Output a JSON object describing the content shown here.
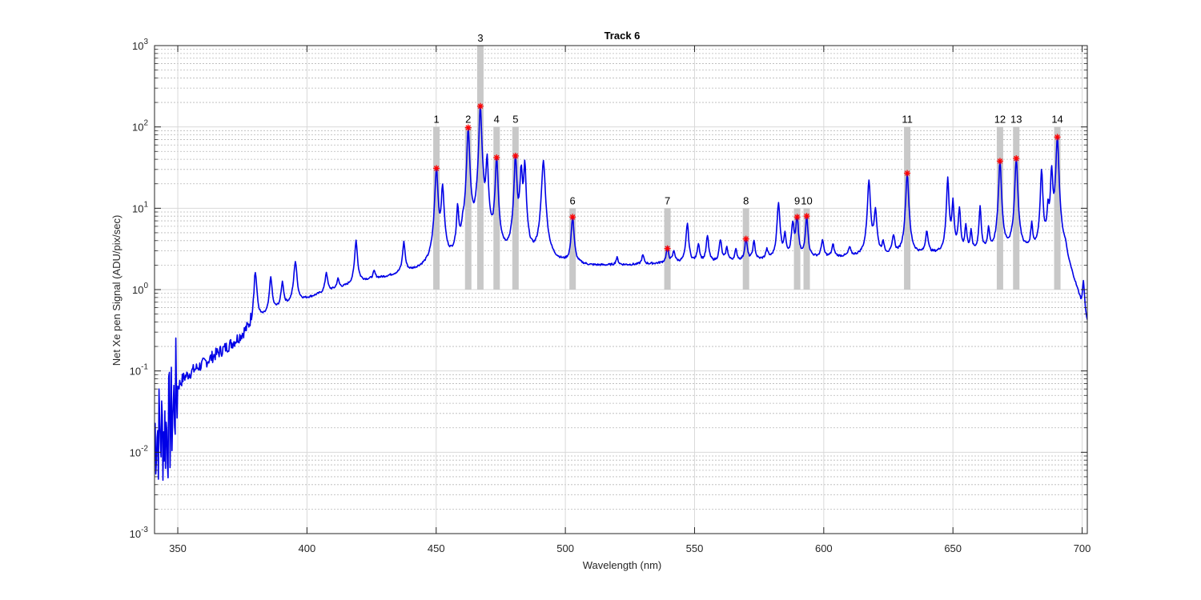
{
  "chart_data": {
    "type": "line",
    "title": "Track 6",
    "xlabel": "Wavelength (nm)",
    "ylabel": "Net Xe pen Signal (ADU/pix/sec)",
    "xlim": [
      341,
      702
    ],
    "ylim": [
      0.001,
      1000
    ],
    "yscale": "log",
    "grid": true,
    "x_ticks": [
      "350",
      "400",
      "450",
      "500",
      "550",
      "600",
      "650",
      "700"
    ],
    "y_ticks": [
      {
        "base": "10",
        "exp": "-3"
      },
      {
        "base": "10",
        "exp": "-2"
      },
      {
        "base": "10",
        "exp": "-1"
      },
      {
        "base": "10",
        "exp": "0"
      },
      {
        "base": "10",
        "exp": "1"
      },
      {
        "base": "10",
        "exp": "2"
      },
      {
        "base": "10",
        "exp": "3"
      }
    ],
    "line_color": "#0000e6",
    "band_color": "#c8c8c8",
    "marker_color": "#ff0000",
    "peaks": [
      {
        "label": "1",
        "x": 450.1,
        "y": 31,
        "band_top": 100
      },
      {
        "label": "2",
        "x": 462.4,
        "y": 98,
        "band_top": 100
      },
      {
        "label": "3",
        "x": 467.1,
        "y": 180,
        "band_top": 1000
      },
      {
        "label": "4",
        "x": 473.4,
        "y": 42,
        "band_top": 100
      },
      {
        "label": "5",
        "x": 480.7,
        "y": 44,
        "band_top": 100
      },
      {
        "label": "6",
        "x": 502.8,
        "y": 7.8,
        "band_top": 10
      },
      {
        "label": "7",
        "x": 539.5,
        "y": 3.2,
        "band_top": 10
      },
      {
        "label": "8",
        "x": 569.9,
        "y": 4.2,
        "band_top": 10
      },
      {
        "label": "9",
        "x": 589.7,
        "y": 7.8,
        "band_top": 10
      },
      {
        "label": "10",
        "x": 593.4,
        "y": 8.0,
        "band_top": 10
      },
      {
        "label": "11",
        "x": 632.3,
        "y": 27,
        "band_top": 100
      },
      {
        "label": "12",
        "x": 668.2,
        "y": 38,
        "band_top": 100
      },
      {
        "label": "13",
        "x": 674.5,
        "y": 41,
        "band_top": 100
      },
      {
        "label": "14",
        "x": 690.4,
        "y": 75,
        "band_top": 100
      }
    ],
    "series": [
      {
        "baseline": [
          [
            341,
            0.01
          ],
          [
            344,
            0.008
          ],
          [
            347,
            0.012
          ],
          [
            349.5,
            0.05
          ],
          [
            352,
            0.07
          ],
          [
            356,
            0.09
          ],
          [
            360,
            0.11
          ],
          [
            364,
            0.14
          ],
          [
            368,
            0.17
          ],
          [
            372,
            0.21
          ],
          [
            376,
            0.27
          ],
          [
            379,
            0.3
          ],
          [
            382,
            0.4
          ],
          [
            386,
            0.5
          ],
          [
            390,
            0.58
          ],
          [
            395,
            0.65
          ],
          [
            400,
            0.75
          ],
          [
            405,
            0.85
          ],
          [
            410,
            0.95
          ],
          [
            415,
            1.05
          ],
          [
            420,
            1.2
          ],
          [
            425,
            1.28
          ],
          [
            430,
            1.35
          ],
          [
            435,
            1.45
          ],
          [
            440,
            1.55
          ],
          [
            445,
            1.65
          ],
          [
            450,
            1.75
          ],
          [
            455,
            1.8
          ],
          [
            460,
            1.9
          ],
          [
            470,
            2.0
          ],
          [
            480,
            2.0
          ],
          [
            490,
            2.0
          ],
          [
            500,
            2.0
          ],
          [
            510,
            1.9
          ],
          [
            520,
            1.95
          ],
          [
            530,
            2.0
          ],
          [
            540,
            2.1
          ],
          [
            550,
            2.1
          ],
          [
            560,
            2.15
          ],
          [
            570,
            2.2
          ],
          [
            580,
            2.3
          ],
          [
            590,
            2.4
          ],
          [
            600,
            2.45
          ],
          [
            610,
            2.5
          ],
          [
            620,
            2.5
          ],
          [
            630,
            2.55
          ],
          [
            640,
            2.65
          ],
          [
            650,
            2.7
          ],
          [
            660,
            2.75
          ],
          [
            670,
            2.8
          ],
          [
            680,
            2.8
          ],
          [
            686,
            2.6
          ],
          [
            690,
            2.4
          ],
          [
            693,
            2.0
          ],
          [
            695,
            1.4
          ],
          [
            697,
            0.9
          ],
          [
            699,
            0.55
          ],
          [
            700,
            0.35
          ],
          [
            701,
            0.3
          ],
          [
            702,
            0.2
          ]
        ],
        "lines": [
          [
            380,
            1.6,
            0.6
          ],
          [
            386,
            1.4,
            0.5
          ],
          [
            390.5,
            1.2,
            0.5
          ],
          [
            395.5,
            2.2,
            0.6
          ],
          [
            407.5,
            1.6,
            0.5
          ],
          [
            412,
            1.3,
            0.5
          ],
          [
            419,
            4.0,
            0.5
          ],
          [
            426,
            1.6,
            0.5
          ],
          [
            437.5,
            3.7,
            0.5
          ],
          [
            450.1,
            31,
            0.5
          ],
          [
            452.5,
            18,
            0.5
          ],
          [
            458.3,
            9.5,
            0.4
          ],
          [
            460.3,
            3.5,
            0.4
          ],
          [
            462.4,
            98,
            0.45
          ],
          [
            467.1,
            180,
            0.45
          ],
          [
            469.7,
            40,
            0.4
          ],
          [
            473.4,
            42,
            0.45
          ],
          [
            480.7,
            44,
            0.45
          ],
          [
            482.9,
            30,
            0.45
          ],
          [
            484.3,
            35,
            0.4
          ],
          [
            491.5,
            38,
            0.6
          ],
          [
            502.8,
            7.8,
            0.5
          ],
          [
            520,
            2.4,
            0.5
          ],
          [
            530,
            2.6,
            0.5
          ],
          [
            539.5,
            3.2,
            0.5
          ],
          [
            542,
            2.9,
            0.5
          ],
          [
            547.2,
            6.5,
            0.5
          ],
          [
            551.5,
            3.6,
            0.5
          ],
          [
            555,
            4.5,
            0.5
          ],
          [
            560,
            4.0,
            0.5
          ],
          [
            562.5,
            3.2,
            0.5
          ],
          [
            566,
            3.0,
            0.5
          ],
          [
            569.9,
            4.2,
            0.5
          ],
          [
            573,
            3.8,
            0.5
          ],
          [
            578,
            3.0,
            0.5
          ],
          [
            582.5,
            11.5,
            0.5
          ],
          [
            585,
            4.5,
            0.5
          ],
          [
            588,
            6.5,
            0.5
          ],
          [
            589.7,
            7.8,
            0.45
          ],
          [
            593.4,
            8.0,
            0.45
          ],
          [
            599.5,
            4.0,
            0.5
          ],
          [
            603.6,
            3.5,
            0.5
          ],
          [
            610,
            3.2,
            0.5
          ],
          [
            617.5,
            22,
            0.5
          ],
          [
            620,
            9.5,
            0.5
          ],
          [
            623,
            3.5,
            0.5
          ],
          [
            627,
            4.5,
            0.5
          ],
          [
            632.3,
            27,
            0.5
          ],
          [
            639.9,
            5.2,
            0.5
          ],
          [
            648,
            24,
            0.4
          ],
          [
            650,
            12,
            0.4
          ],
          [
            652.5,
            10,
            0.4
          ],
          [
            655,
            6.0,
            0.4
          ],
          [
            657,
            5.0,
            0.4
          ],
          [
            660.5,
            10.5,
            0.4
          ],
          [
            663.8,
            5.5,
            0.4
          ],
          [
            668.2,
            38,
            0.45
          ],
          [
            674.5,
            41,
            0.45
          ],
          [
            680.5,
            6.0,
            0.4
          ],
          [
            684.3,
            30,
            0.4
          ],
          [
            686.8,
            9.0,
            0.4
          ],
          [
            688.2,
            30,
            0.4
          ],
          [
            690.4,
            75,
            0.45
          ],
          [
            693.5,
            2.6,
            0.4
          ],
          [
            700.5,
            1.1,
            0.35
          ]
        ]
      }
    ]
  }
}
